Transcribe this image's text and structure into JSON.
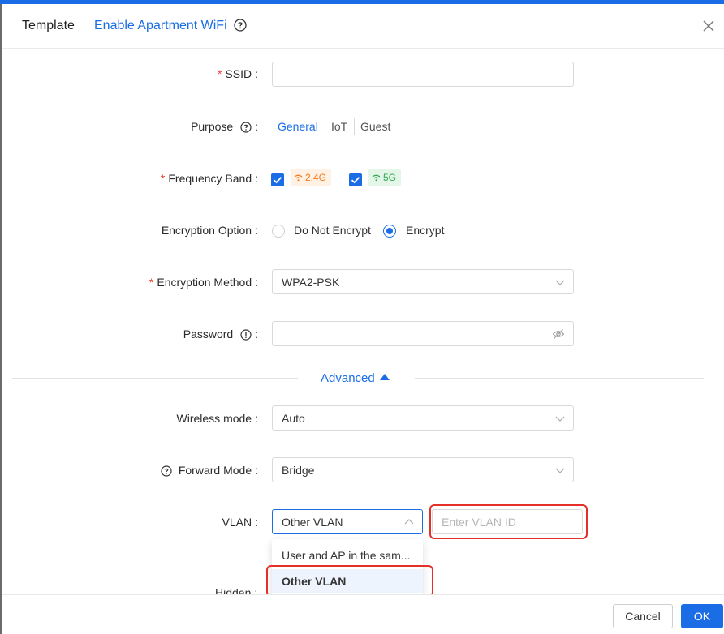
{
  "header": {
    "template_label": "Template",
    "title": "Enable Apartment WiFi"
  },
  "form": {
    "ssid": {
      "label": "SSID",
      "required": true,
      "value": "",
      "placeholder": ""
    },
    "purpose": {
      "label": "Purpose",
      "options": [
        "General",
        "IoT",
        "Guest"
      ],
      "selected": "General"
    },
    "frequency_band": {
      "label": "Frequency Band",
      "required": true,
      "band_24": "2.4G",
      "band_5": "5G",
      "band_24_checked": true,
      "band_5_checked": true
    },
    "encryption_option": {
      "label": "Encryption Option",
      "options": [
        "Do Not Encrypt",
        "Encrypt"
      ],
      "selected": "Encrypt"
    },
    "encryption_method": {
      "label": "Encryption Method",
      "required": true,
      "value": "WPA2-PSK"
    },
    "password": {
      "label": "Password",
      "value": ""
    },
    "advanced_label": "Advanced",
    "wireless_mode": {
      "label": "Wireless mode",
      "value": "Auto"
    },
    "forward_mode": {
      "label": "Forward Mode",
      "value": "Bridge"
    },
    "vlan": {
      "label": "VLAN",
      "value": "Other VLAN",
      "vlan_id_placeholder": "Enter VLAN ID",
      "dropdown_options": [
        "User and AP in the sam...",
        "Other VLAN"
      ],
      "dropdown_selected": "Other VLAN"
    },
    "hidden": {
      "label": "Hidden"
    }
  },
  "footer": {
    "cancel_label": "Cancel",
    "ok_label": "OK"
  },
  "colors": {
    "accent": "#1b6de6",
    "required": "#e8412f",
    "highlight_box": "#e5302a",
    "band_24_text": "#f07a1e",
    "band_24_bg": "#fff1e3",
    "band_5_text": "#2fa84f",
    "band_5_bg": "#e4f6e8"
  }
}
